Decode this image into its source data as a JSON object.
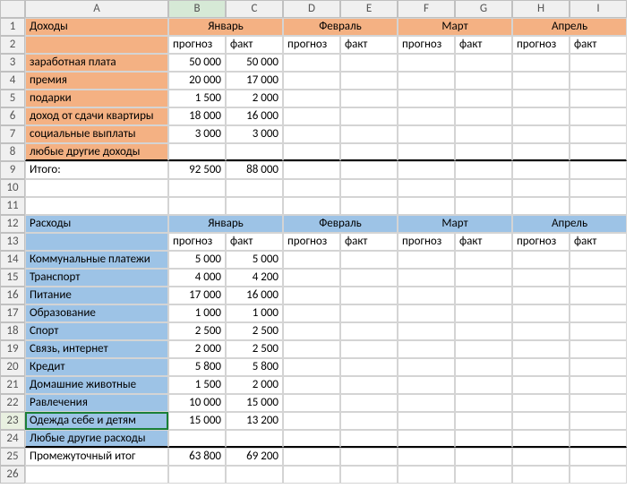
{
  "columns": [
    "A",
    "B",
    "C",
    "D",
    "E",
    "F",
    "G",
    "H",
    "I"
  ],
  "row_numbers": [
    1,
    2,
    3,
    4,
    5,
    6,
    7,
    8,
    9,
    10,
    11,
    12,
    13,
    14,
    15,
    16,
    17,
    18,
    19,
    20,
    21,
    22,
    23,
    24,
    25,
    26
  ],
  "selected_column": "B",
  "selected_cell_row": 23,
  "income": {
    "header": "Доходы",
    "months": [
      "Январь",
      "Февраль",
      "Март",
      "Апрель"
    ],
    "subcols": {
      "forecast": "прогноз",
      "fact": "факт"
    },
    "rows": [
      {
        "label": "заработная плата",
        "forecast": 50000,
        "fact": 50000
      },
      {
        "label": "премия",
        "forecast": 20000,
        "fact": 17000
      },
      {
        "label": "подарки",
        "forecast": 1500,
        "fact": 2000
      },
      {
        "label": "доход от сдачи квартиры",
        "forecast": 18000,
        "fact": 16000
      },
      {
        "label": "социальные выплаты",
        "forecast": 3000,
        "fact": 3000
      },
      {
        "label": "любые другие доходы",
        "forecast": null,
        "fact": null
      }
    ],
    "total": {
      "label": "Итого:",
      "forecast": 92500,
      "fact": 88000
    }
  },
  "expenses": {
    "header": "Расходы",
    "months": [
      "Январь",
      "Февраль",
      "Март",
      "Апрель"
    ],
    "subcols": {
      "forecast": "прогноз",
      "fact": "факт"
    },
    "rows": [
      {
        "label": "Коммунальные платежи",
        "forecast": 5000,
        "fact": 5000
      },
      {
        "label": "Транспорт",
        "forecast": 4000,
        "fact": 4200
      },
      {
        "label": "Питание",
        "forecast": 17000,
        "fact": 16000
      },
      {
        "label": "Образование",
        "forecast": 1000,
        "fact": 1000
      },
      {
        "label": "Спорт",
        "forecast": 2500,
        "fact": 2500
      },
      {
        "label": "Связь, интернет",
        "forecast": 2000,
        "fact": 2500
      },
      {
        "label": "Кредит",
        "forecast": 5800,
        "fact": 5800
      },
      {
        "label": "Домашние животные",
        "forecast": 1500,
        "fact": 2000
      },
      {
        "label": "Равлечения",
        "forecast": 10000,
        "fact": 15000
      },
      {
        "label": "Одежда себе и детям",
        "forecast": 15000,
        "fact": 13200
      },
      {
        "label": "Любые другие расходы",
        "forecast": null,
        "fact": null
      }
    ],
    "total": {
      "label": "Промежуточный итог",
      "forecast": 63800,
      "fact": 69200
    }
  }
}
